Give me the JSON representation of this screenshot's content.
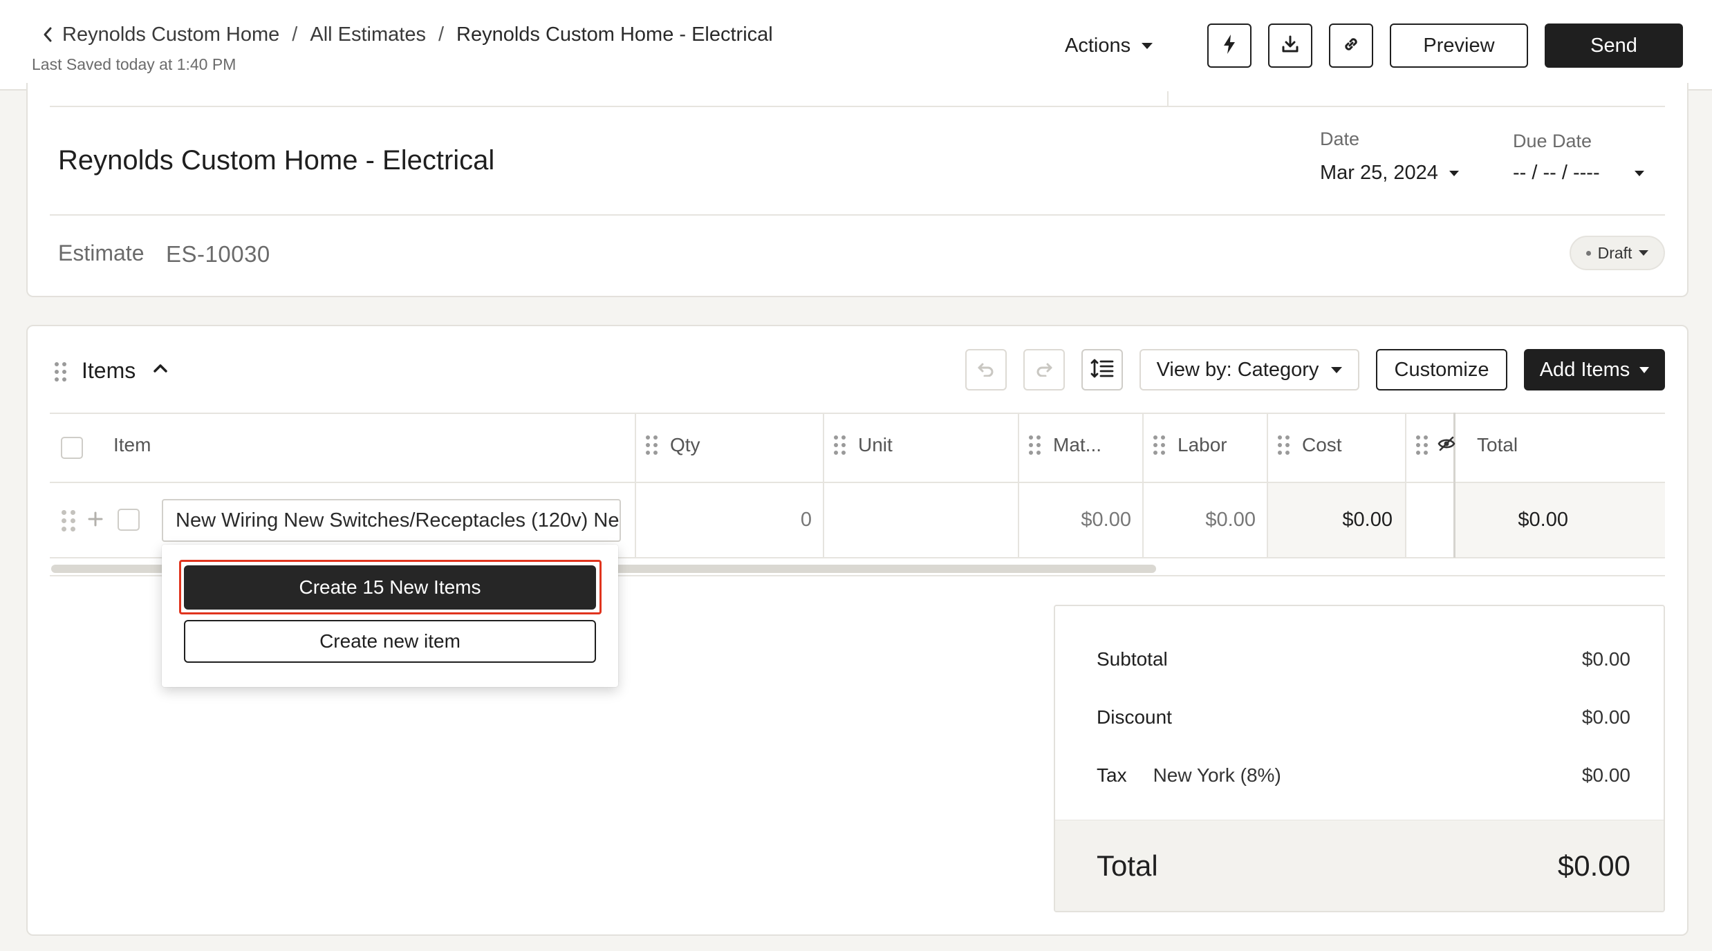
{
  "header": {
    "breadcrumbs": [
      "Reynolds Custom Home",
      "All Estimates",
      "Reynolds Custom Home - Electrical"
    ],
    "separator": "/",
    "saved_text": "Last Saved today at 1:40 PM",
    "actions_label": "Actions",
    "preview_label": "Preview",
    "send_label": "Send",
    "icons": [
      "lightning-icon",
      "download-icon",
      "link-icon"
    ]
  },
  "estimate": {
    "title": "Reynolds Custom Home - Electrical",
    "date_label": "Date",
    "date_value": "Mar 25, 2024",
    "due_date_label": "Due Date",
    "due_date_value": "-- / -- / ----",
    "estimate_label": "Estimate",
    "estimate_number": "ES-10030",
    "status": "Draft"
  },
  "items": {
    "title": "Items",
    "view_by_label": "View by: Category",
    "customize_label": "Customize",
    "add_items_label": "Add Items",
    "columns": [
      "Item",
      "Qty",
      "Unit",
      "Mat...",
      "Labor",
      "Cost",
      "Total"
    ],
    "row": {
      "name": "New Wiring New Switches/Receptacles (120v) Ne",
      "qty": "0",
      "unit": "",
      "material": "$0.00",
      "labor": "$0.00",
      "cost": "$0.00",
      "total": "$0.00"
    },
    "popup": {
      "primary": "Create 15 New Items",
      "secondary": "Create new item"
    }
  },
  "totals": {
    "subtotal_label": "Subtotal",
    "subtotal": "$0.00",
    "discount_label": "Discount",
    "discount": "$0.00",
    "tax_label": "Tax",
    "tax_region": "New York (8%)",
    "tax": "$0.00",
    "total_label": "Total",
    "total": "$0.00"
  },
  "colors": {
    "accent_dark": "#1f1f1f",
    "highlight": "#e0341e",
    "background": "#f5f4f1"
  }
}
